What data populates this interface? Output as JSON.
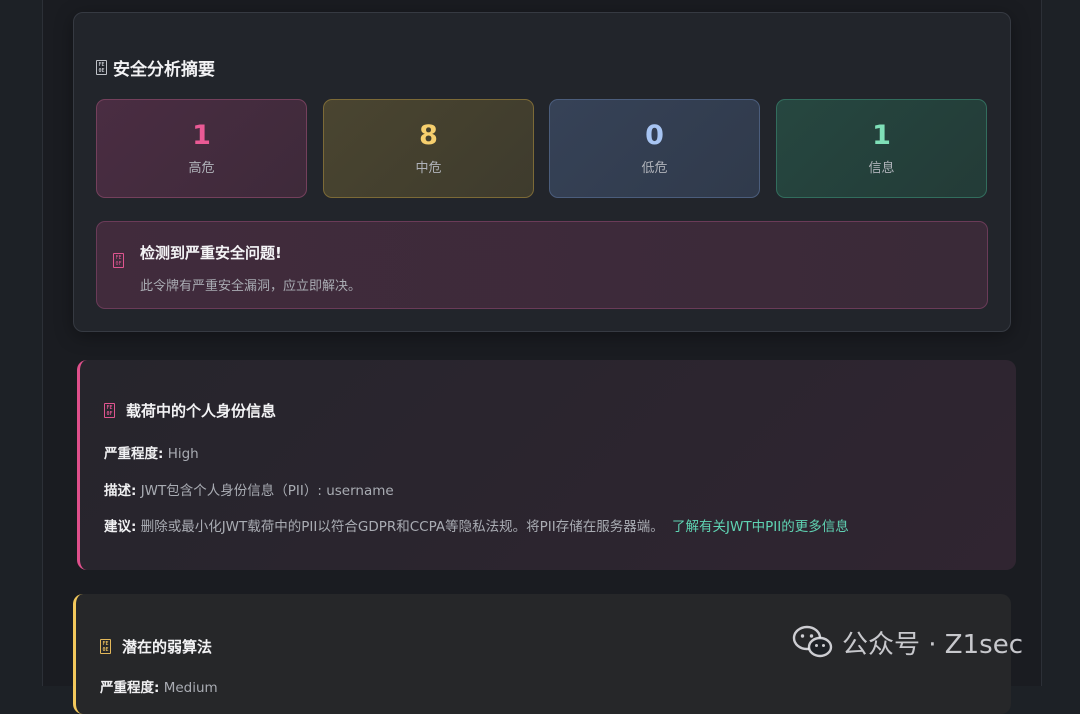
{
  "summary": {
    "title": "安全分析摘要",
    "stats": [
      {
        "value": "1",
        "label": "高危"
      },
      {
        "value": "8",
        "label": "中危"
      },
      {
        "value": "0",
        "label": "低危"
      },
      {
        "value": "1",
        "label": "信息"
      }
    ],
    "alert": {
      "title": "检测到严重安全问题!",
      "description": "此令牌有严重安全漏洞，应立即解决。"
    }
  },
  "findings": [
    {
      "title": "载荷中的个人身份信息",
      "severity_label": "严重程度:",
      "severity": "High",
      "description_label": "描述:",
      "description": "JWT包含个人身份信息（PII）: username",
      "recommendation_label": "建议:",
      "recommendation": "删除或最小化JWT载荷中的PII以符合GDPR和CCPA等隐私法规。将PII存储在服务器端。",
      "link": "了解有关JWT中PII的更多信息"
    },
    {
      "title": "潜在的弱算法",
      "severity_label": "严重程度:",
      "severity": "Medium"
    }
  ],
  "watermark": {
    "text": "公众号 · Z1sec",
    "icon": "wechat-icon"
  },
  "colors": {
    "high": "#ea5a95",
    "medium": "#f6cf6e",
    "low": "#a7c4f2",
    "info": "#7fe0b8",
    "link": "#5fd3b3"
  }
}
